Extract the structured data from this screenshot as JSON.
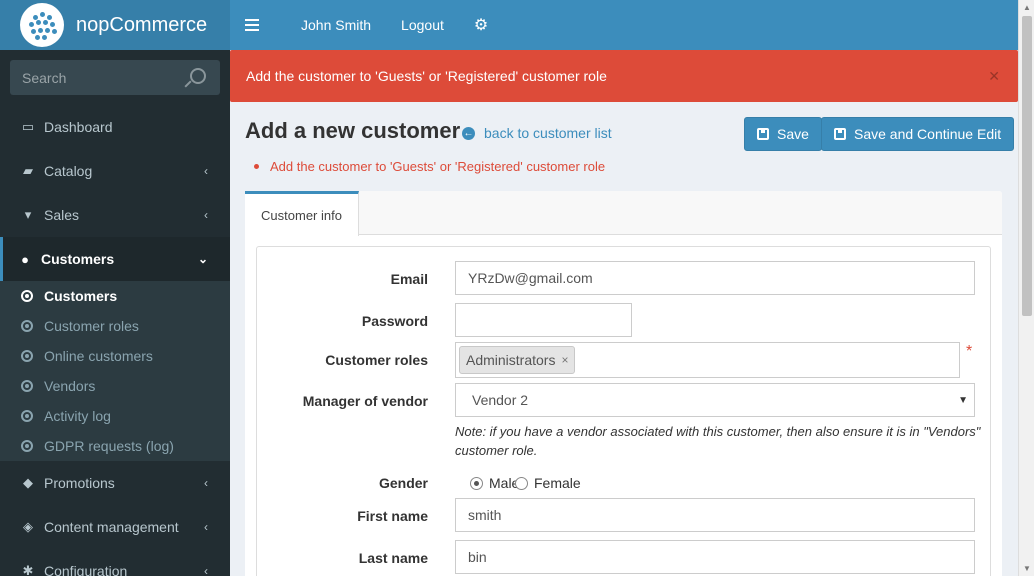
{
  "brand": {
    "name": "nopCommerce"
  },
  "search": {
    "placeholder": "Search"
  },
  "sidebar": {
    "items": [
      {
        "label": "Dashboard",
        "icon": "desktop-icon"
      },
      {
        "label": "Catalog",
        "icon": "book-icon"
      },
      {
        "label": "Sales",
        "icon": "cart-icon"
      },
      {
        "label": "Customers",
        "icon": "user-icon"
      },
      {
        "label": "Promotions",
        "icon": "tags-icon"
      },
      {
        "label": "Content management",
        "icon": "cubes-icon"
      },
      {
        "label": "Configuration",
        "icon": "gears-icon"
      }
    ],
    "customers_sub": [
      "Customers",
      "Customer roles",
      "Online customers",
      "Vendors",
      "Activity log",
      "GDPR requests (log)"
    ]
  },
  "topbar": {
    "user": "John Smith",
    "logout": "Logout"
  },
  "alert": {
    "message": "Add the customer to 'Guests' or 'Registered' customer role"
  },
  "header": {
    "title": "Add a new customer",
    "back_link": "back to customer list",
    "save": "Save",
    "save_continue": "Save and Continue Edit"
  },
  "errors": [
    "Add the customer to 'Guests' or 'Registered' customer role"
  ],
  "tabs": [
    "Customer info"
  ],
  "form": {
    "email_label": "Email",
    "email_value": "YRzDw@gmail.com",
    "password_label": "Password",
    "password_value": "",
    "roles_label": "Customer roles",
    "roles": [
      "Administrators"
    ],
    "vendor_label": "Manager of vendor",
    "vendor_value": "Vendor 2",
    "vendor_note": "Note: if you have a vendor associated with this customer, then also ensure it is in \"Vendors\" customer role.",
    "gender_label": "Gender",
    "gender_options": [
      "Male",
      "Female"
    ],
    "gender_selected": "Male",
    "firstname_label": "First name",
    "firstname_value": "smith",
    "lastname_label": "Last name",
    "lastname_value": "bin"
  },
  "colors": {
    "primary": "#3c8dbc",
    "sidebar": "#222d32",
    "danger": "#dd4b39"
  }
}
